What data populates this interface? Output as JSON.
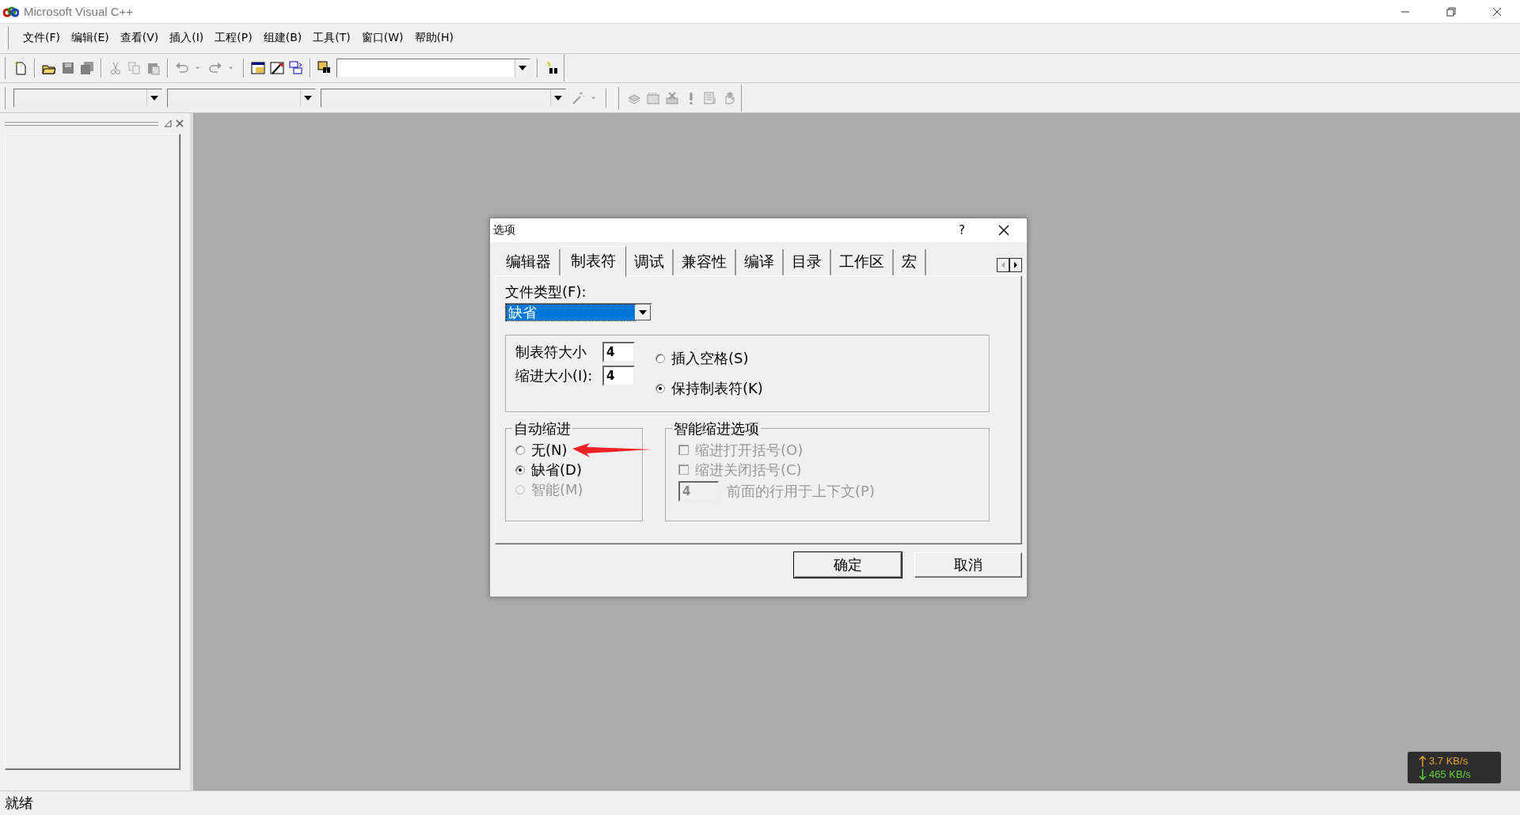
{
  "window": {
    "title": "Microsoft Visual C++"
  },
  "menu": [
    {
      "label": "文件(F)"
    },
    {
      "label": "编辑(E)"
    },
    {
      "label": "查看(V)"
    },
    {
      "label": "插入(I)"
    },
    {
      "label": "工程(P)"
    },
    {
      "label": "组建(B)"
    },
    {
      "label": "工具(T)"
    },
    {
      "label": "窗口(W)"
    },
    {
      "label": "帮助(H)"
    }
  ],
  "dialog": {
    "title": "选项",
    "help": "?",
    "tabs": [
      {
        "label": "编辑器",
        "selected": false
      },
      {
        "label": "制表符",
        "selected": true
      },
      {
        "label": "调试",
        "selected": false
      },
      {
        "label": "兼容性",
        "selected": false
      },
      {
        "label": "编译",
        "selected": false
      },
      {
        "label": "目录",
        "selected": false
      },
      {
        "label": "工作区",
        "selected": false
      },
      {
        "label": "宏",
        "selected": false
      }
    ],
    "file_type": {
      "label": "文件类型(F):",
      "value": "缺省"
    },
    "tab_settings": {
      "fields": [
        {
          "label": "制表符大小",
          "value": "4"
        },
        {
          "label": "缩进大小(I):",
          "value": "4"
        }
      ],
      "options": [
        {
          "label": "插入空格(S)",
          "selected": false
        },
        {
          "label": "保持制表符(K)",
          "selected": true
        }
      ]
    },
    "auto_indent": {
      "title": "自动缩进",
      "options": [
        {
          "label": "无(N)",
          "selected": false,
          "disabled": false
        },
        {
          "label": "缺省(D)",
          "selected": true,
          "disabled": false
        },
        {
          "label": "智能(M)",
          "selected": false,
          "disabled": true
        }
      ]
    },
    "smart_indent": {
      "title": "智能缩进选项",
      "disabled": true,
      "checkboxes": [
        {
          "label": "缩进打开括号(O)",
          "checked": false
        },
        {
          "label": "缩进关闭括号(C)",
          "checked": false
        }
      ],
      "context": {
        "value": "4",
        "label": "前面的行用于上下文(P)"
      }
    },
    "buttons": [
      "确定",
      "取消"
    ]
  },
  "status_bar": {
    "text": "就绪"
  },
  "net_speed": {
    "upload": "3.7 KB/s",
    "download": "465 KB/s"
  }
}
